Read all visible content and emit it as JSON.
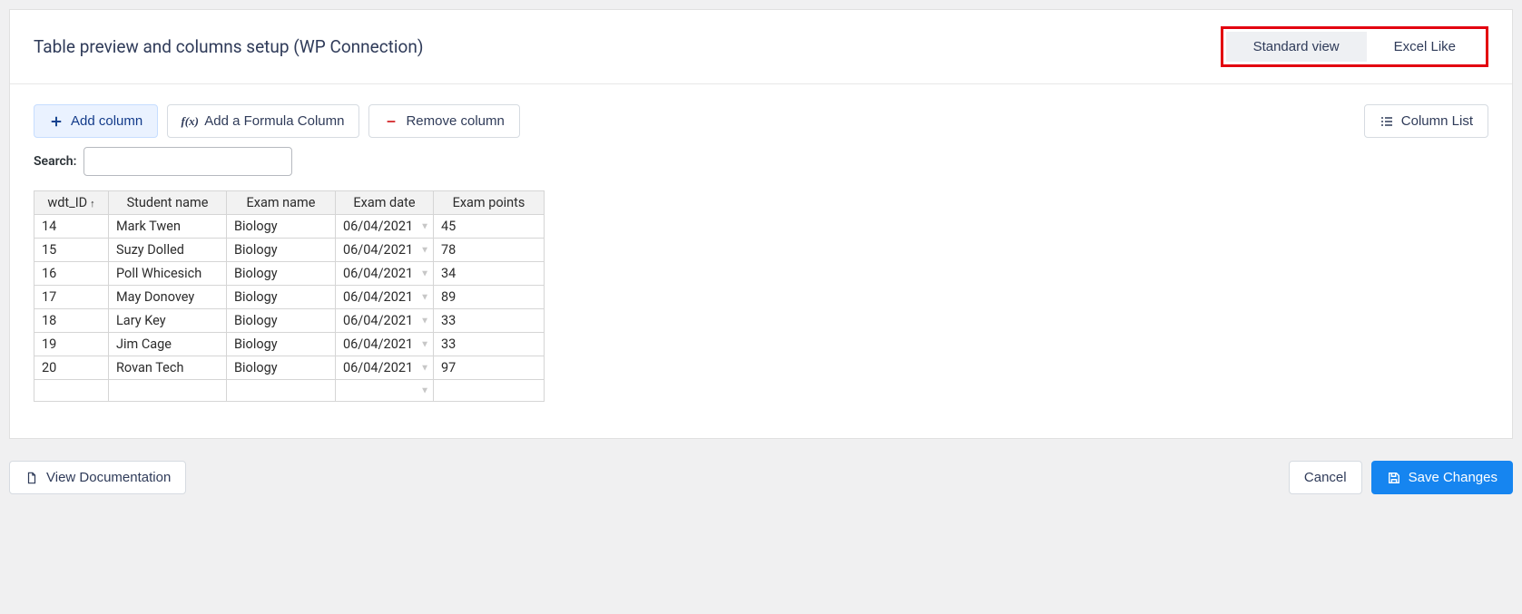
{
  "header": {
    "title": "Table preview and columns setup (WP Connection)",
    "view_standard": "Standard view",
    "view_excel": "Excel Like"
  },
  "toolbar": {
    "add_column": "Add column",
    "add_formula": "Add a Formula Column",
    "remove_column": "Remove column",
    "column_list": "Column List"
  },
  "search": {
    "label": "Search:",
    "value": ""
  },
  "table": {
    "columns": [
      "wdt_ID",
      "Student name",
      "Exam name",
      "Exam date",
      "Exam points"
    ],
    "rows": [
      {
        "id": "14",
        "student": "Mark Twen",
        "exam": "Biology",
        "date": "06/04/2021",
        "points": "45"
      },
      {
        "id": "15",
        "student": "Suzy Dolled",
        "exam": "Biology",
        "date": "06/04/2021",
        "points": "78"
      },
      {
        "id": "16",
        "student": "Poll Whicesich",
        "exam": "Biology",
        "date": "06/04/2021",
        "points": "34"
      },
      {
        "id": "17",
        "student": "May Donovey",
        "exam": "Biology",
        "date": "06/04/2021",
        "points": "89"
      },
      {
        "id": "18",
        "student": "Lary Key",
        "exam": "Biology",
        "date": "06/04/2021",
        "points": "33"
      },
      {
        "id": "19",
        "student": "Jim Cage",
        "exam": "Biology",
        "date": "06/04/2021",
        "points": "33"
      },
      {
        "id": "20",
        "student": "Rovan Tech",
        "exam": "Biology",
        "date": "06/04/2021",
        "points": "97"
      }
    ]
  },
  "footer": {
    "view_docs": "View Documentation",
    "cancel": "Cancel",
    "save": "Save Changes"
  }
}
